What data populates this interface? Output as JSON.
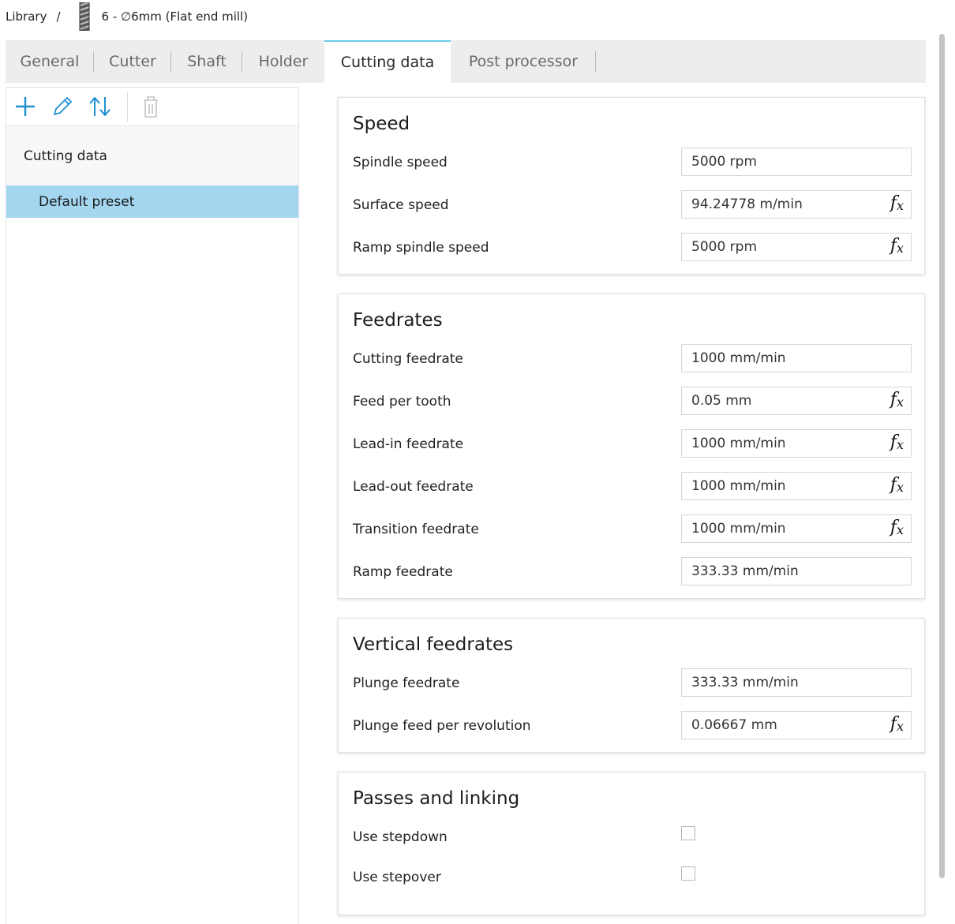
{
  "breadcrumb": {
    "library": "Library",
    "separator": "/",
    "tool_name": "6 - ∅6mm (Flat end mill)"
  },
  "tabs": [
    "General",
    "Cutter",
    "Shaft",
    "Holder",
    "Cutting data",
    "Post processor"
  ],
  "active_tab": "Cutting data",
  "toolbar": {
    "icons": [
      "add-icon",
      "edit-icon",
      "sort-icon",
      "delete-icon"
    ]
  },
  "tree": {
    "header": "Cutting data",
    "items": [
      "Default preset"
    ]
  },
  "sections": {
    "speed": {
      "title": "Speed",
      "rows": [
        {
          "label": "Spindle speed",
          "value": "5000 rpm"
        },
        {
          "label": "Surface speed",
          "value": "94.24778 m/min"
        },
        {
          "label": "Ramp spindle speed",
          "value": "5000 rpm"
        }
      ]
    },
    "feedrates": {
      "title": "Feedrates",
      "rows": [
        {
          "label": "Cutting feedrate",
          "value": "1000 mm/min"
        },
        {
          "label": "Feed per tooth",
          "value": "0.05 mm"
        },
        {
          "label": "Lead-in feedrate",
          "value": "1000 mm/min"
        },
        {
          "label": "Lead-out feedrate",
          "value": "1000 mm/min"
        },
        {
          "label": "Transition feedrate",
          "value": "1000 mm/min"
        },
        {
          "label": "Ramp feedrate",
          "value": "333.33 mm/min"
        }
      ]
    },
    "vertical": {
      "title": "Vertical feedrates",
      "rows": [
        {
          "label": "Plunge feedrate",
          "value": "333.33 mm/min"
        },
        {
          "label": "Plunge feed per revolution",
          "value": "0.06667 mm"
        }
      ]
    },
    "passes": {
      "title": "Passes and linking",
      "rows": [
        {
          "label": "Use stepdown",
          "checked": false
        },
        {
          "label": "Use stepover",
          "checked": false
        }
      ]
    }
  },
  "fx_symbol": "f",
  "fx_sub": "x",
  "colors": {
    "active_tab_accent": "#6dc8e8",
    "selected_item": "#a4d6f0",
    "icon_blue": "#1d8fd0",
    "tab_bar_bg": "#ededed"
  }
}
